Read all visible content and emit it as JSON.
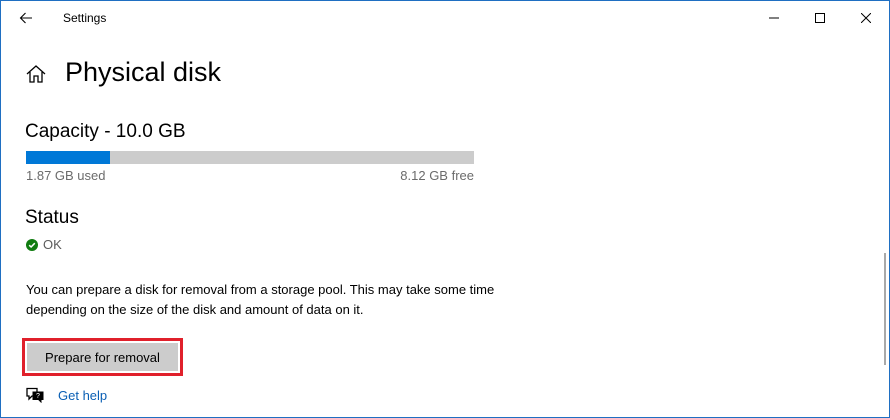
{
  "window": {
    "title": "Settings",
    "controls": [
      "minimize-icon",
      "maximize-icon",
      "close-icon"
    ]
  },
  "header": {
    "title": "Physical disk"
  },
  "capacity": {
    "title": "Capacity - 10.0 GB",
    "used_fraction": 0.187,
    "used_label": "1.87 GB used",
    "free_label": "8.12 GB free"
  },
  "status": {
    "title": "Status",
    "value": "OK"
  },
  "description": "You can prepare a disk for removal from a storage pool. This may take some time depending on the size of the disk and amount of data on it.",
  "actions": {
    "prepare_label": "Prepare for removal"
  },
  "help": {
    "label": "Get help"
  },
  "colors": {
    "accent": "#0078d7",
    "highlight": "#e0202b",
    "ok": "#107c10"
  }
}
